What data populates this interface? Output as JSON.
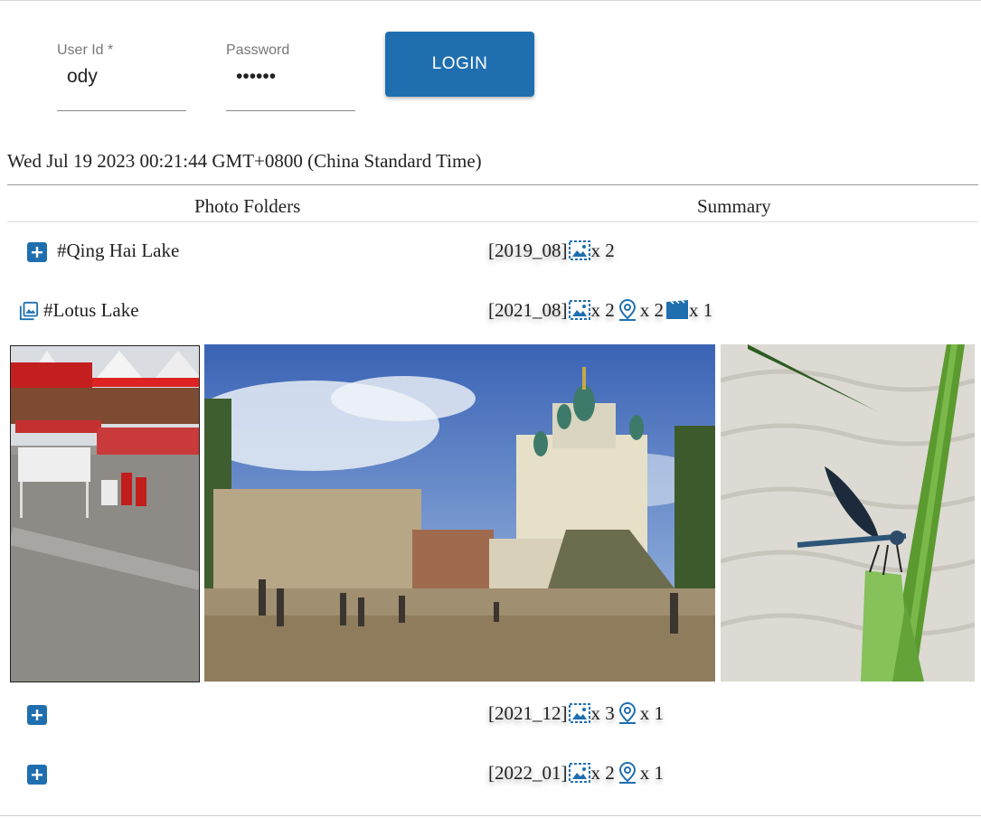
{
  "login": {
    "user_label": "User Id  *",
    "user_value": "ody",
    "password_label": "Password",
    "password_value": "••••••",
    "button_label": "LOGIN"
  },
  "datetime": "Wed Jul 19 2023 00:21:44 GMT+0800 (China Standard Time)",
  "table": {
    "col_folders": "Photo Folders",
    "col_summary": "Summary",
    "rows": [
      {
        "folder": "#Qing Hai Lake",
        "date": "[2019_08]",
        "photos": "x 2",
        "places": "",
        "videos": "",
        "expanded": false
      },
      {
        "folder": "#Lotus Lake",
        "date": "[2021_08]",
        "photos": "x 2",
        "places": "x 2",
        "videos": "x 1",
        "expanded": true
      },
      {
        "folder": "",
        "date": "[2021_12]",
        "photos": "x 3",
        "places": "x 1",
        "videos": "",
        "expanded": false
      },
      {
        "folder": "",
        "date": "[2022_01]",
        "photos": "x 2",
        "places": "x 1",
        "videos": "",
        "expanded": false
      }
    ]
  },
  "colors": {
    "accent": "#1f6fb0",
    "icon_blue": "#1f6fb0"
  }
}
